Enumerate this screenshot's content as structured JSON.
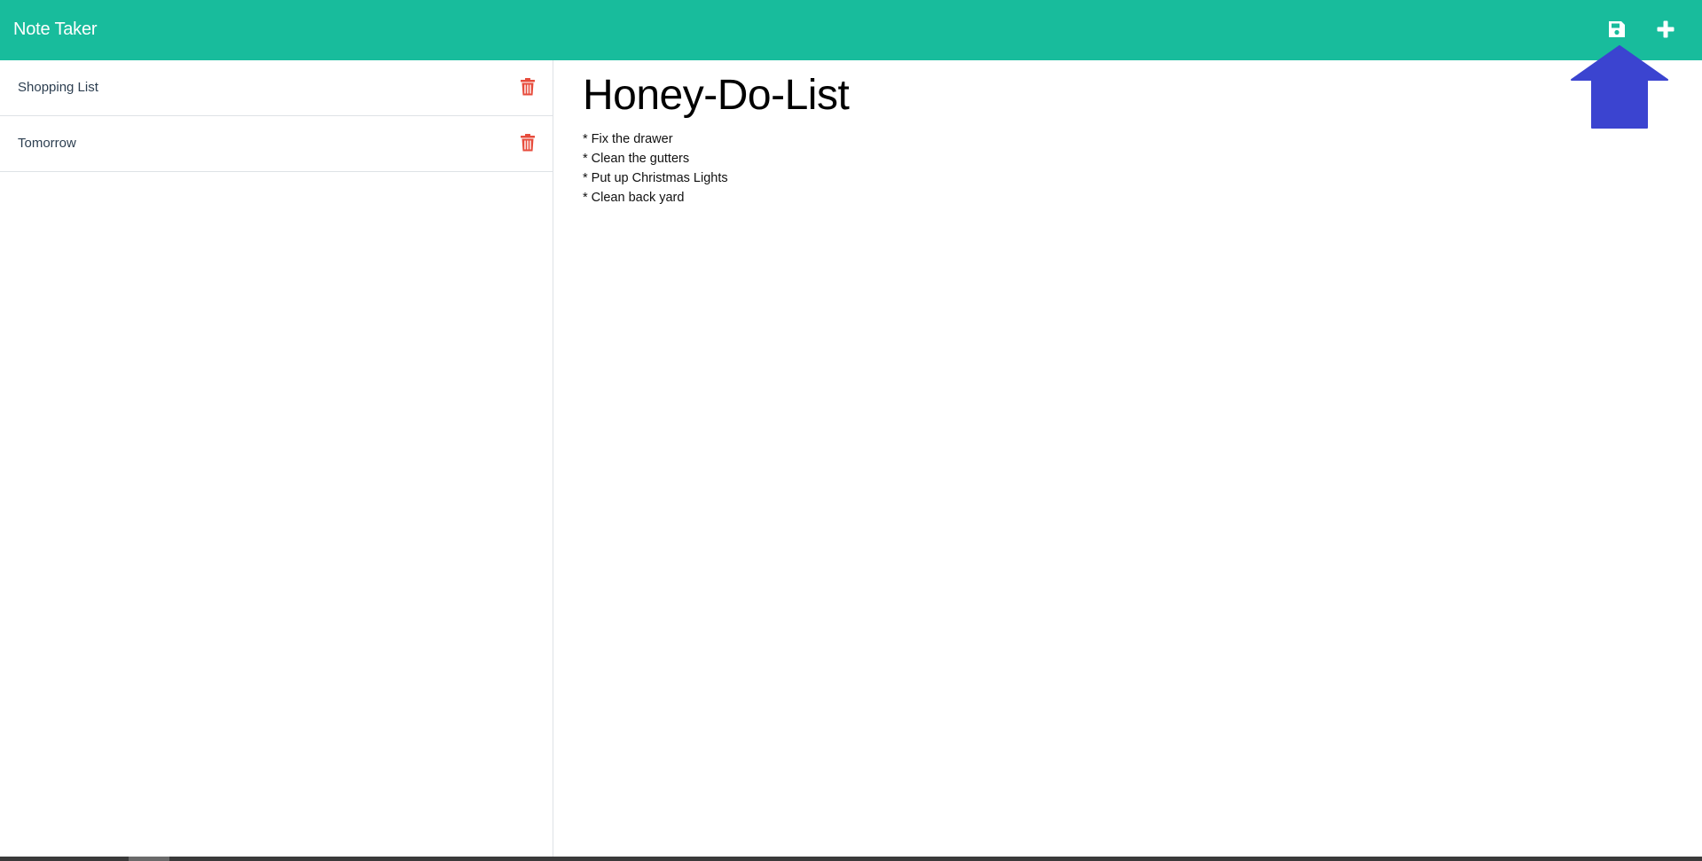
{
  "app": {
    "title": "Note Taker"
  },
  "toolbar": {
    "save_icon": "save-icon",
    "new_icon": "plus-icon"
  },
  "sidebar": {
    "notes": [
      {
        "label": "Shopping List",
        "delete_icon": "trash-icon"
      },
      {
        "label": "Tomorrow",
        "delete_icon": "trash-icon"
      }
    ]
  },
  "editor": {
    "title": "Honey-Do-List",
    "text": "* Fix the drawer\n* Clean the gutters\n* Put up Christmas Lights\n* Clean back yard"
  },
  "annotation": {
    "arrow_icon": "up-arrow-icon"
  },
  "colors": {
    "navbar": "#18bc9c",
    "trash": "#e74c3c",
    "arrow": "#3b44d0"
  }
}
